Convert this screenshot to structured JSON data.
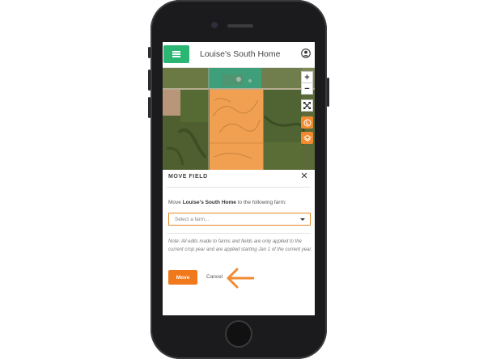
{
  "header": {
    "menu_icon": "hamburger-menu-icon",
    "title": "Louise's South Home",
    "user_icon": "user-account-icon"
  },
  "map": {
    "controls": {
      "zoom_in_label": "+",
      "zoom_out_label": "−",
      "fullscreen_icon": "expand-arrows-icon",
      "location_icon": "globe-locate-icon",
      "layers_icon": "layers-stack-icon"
    }
  },
  "modal": {
    "title": "MOVE FIELD",
    "close_label": "✕",
    "instruction_prefix": "Move ",
    "field_name": "Louise's South Home",
    "instruction_suffix": " to the following farm:",
    "farm_select": {
      "placeholder": "Select a farm..."
    },
    "note": "Note: All edits made to farms and fields are only applied to the current crop year and are applied starting Jan 1 of the current year.",
    "move_button_label": "Move",
    "cancel_label": "Cancel"
  },
  "colors": {
    "accent_green": "#2bb673",
    "accent_orange": "#f2781c",
    "field_highlight": "#f0a050",
    "annotation_orange": "#f28a30"
  }
}
